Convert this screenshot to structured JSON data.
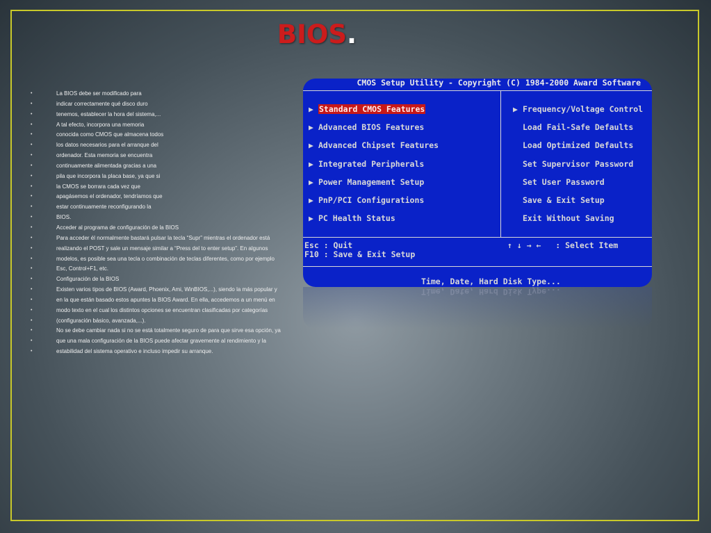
{
  "slide": {
    "title": "BIOS",
    "title_dot": ".",
    "bullets": [
      "La BIOS debe ser modificado para",
      "indicar correctamente qué disco duro",
      "tenemos, establecer la hora del sistema,...",
      "A tal efecto, incorpora una memoria",
      "conocida como CMOS que almacena todos",
      "los datos necesarios para el arranque del",
      "ordenador. Esta memoria se encuentra",
      "continuamente alimentada gracias a una",
      "pila que incorpora la placa base, ya que si",
      "la CMOS se borrara cada vez que",
      "apagásemos el ordenador, tendríamos que",
      "estar continuamente reconfigurando la",
      "BIOS.",
      "Acceder al programa de configuración de la BIOS",
      "Para acceder él normalmente bastará pulsar la tecla “Supr” mientras el ordenador está",
      "realizando el POST y sale un mensaje similar a “Press del to enter setup”. En algunos",
      "modelos, es posible sea una tecla o combinación de teclas diferentes, como por ejemplo",
      "Esc, Control+F1, etc.",
      "Configuración de la BIOS",
      "Existen varios tipos de BIOS (Award, Phoenix, Ami, WinBIOS,...), siendo la más popular y",
      "en la que están basado estos apuntes la BIOS Award. En ella, accedemos a un menú en",
      "modo texto en el cual los distintos opciones se encuentran clasificadas por categorías",
      "(configuración básico, avanzada,...).",
      "No se debe cambiar nada si no se está totalmente seguro de para que sirve esa opción, ya",
      "que una mala configuración de la BIOS puede afectar gravemente al rendimiento y la",
      "estabilidad del sistema operativo e incluso impedir su arranque."
    ],
    "bullet_glyph": "•"
  },
  "bios_screen": {
    "header": "CMOS Setup Utility - Copyright (C) 1984-2000 Award Software",
    "left_items": [
      "Standard CMOS Features",
      "Advanced BIOS Features",
      "Advanced Chipset Features",
      "Integrated Peripherals",
      "Power Management Setup",
      "PnP/PCI Configurations",
      "PC Health Status"
    ],
    "right_items": [
      "Frequency/Voltage Control",
      "Load Fail-Safe Defaults",
      "Load Optimized Defaults",
      "Set Supervisor Password",
      "Set User Password",
      "Save & Exit Setup",
      "Exit Without Saving"
    ],
    "footer_left_1": "Esc : Quit",
    "footer_left_2": "F10 : Save & Exit Setup",
    "footer_right": "↑ ↓ → ←   : Select Item",
    "status": "Time, Date, Hard Disk Type...",
    "arrow_glyph": "▶",
    "selected_color": "#c81818",
    "background_color": "#0a22c8"
  }
}
